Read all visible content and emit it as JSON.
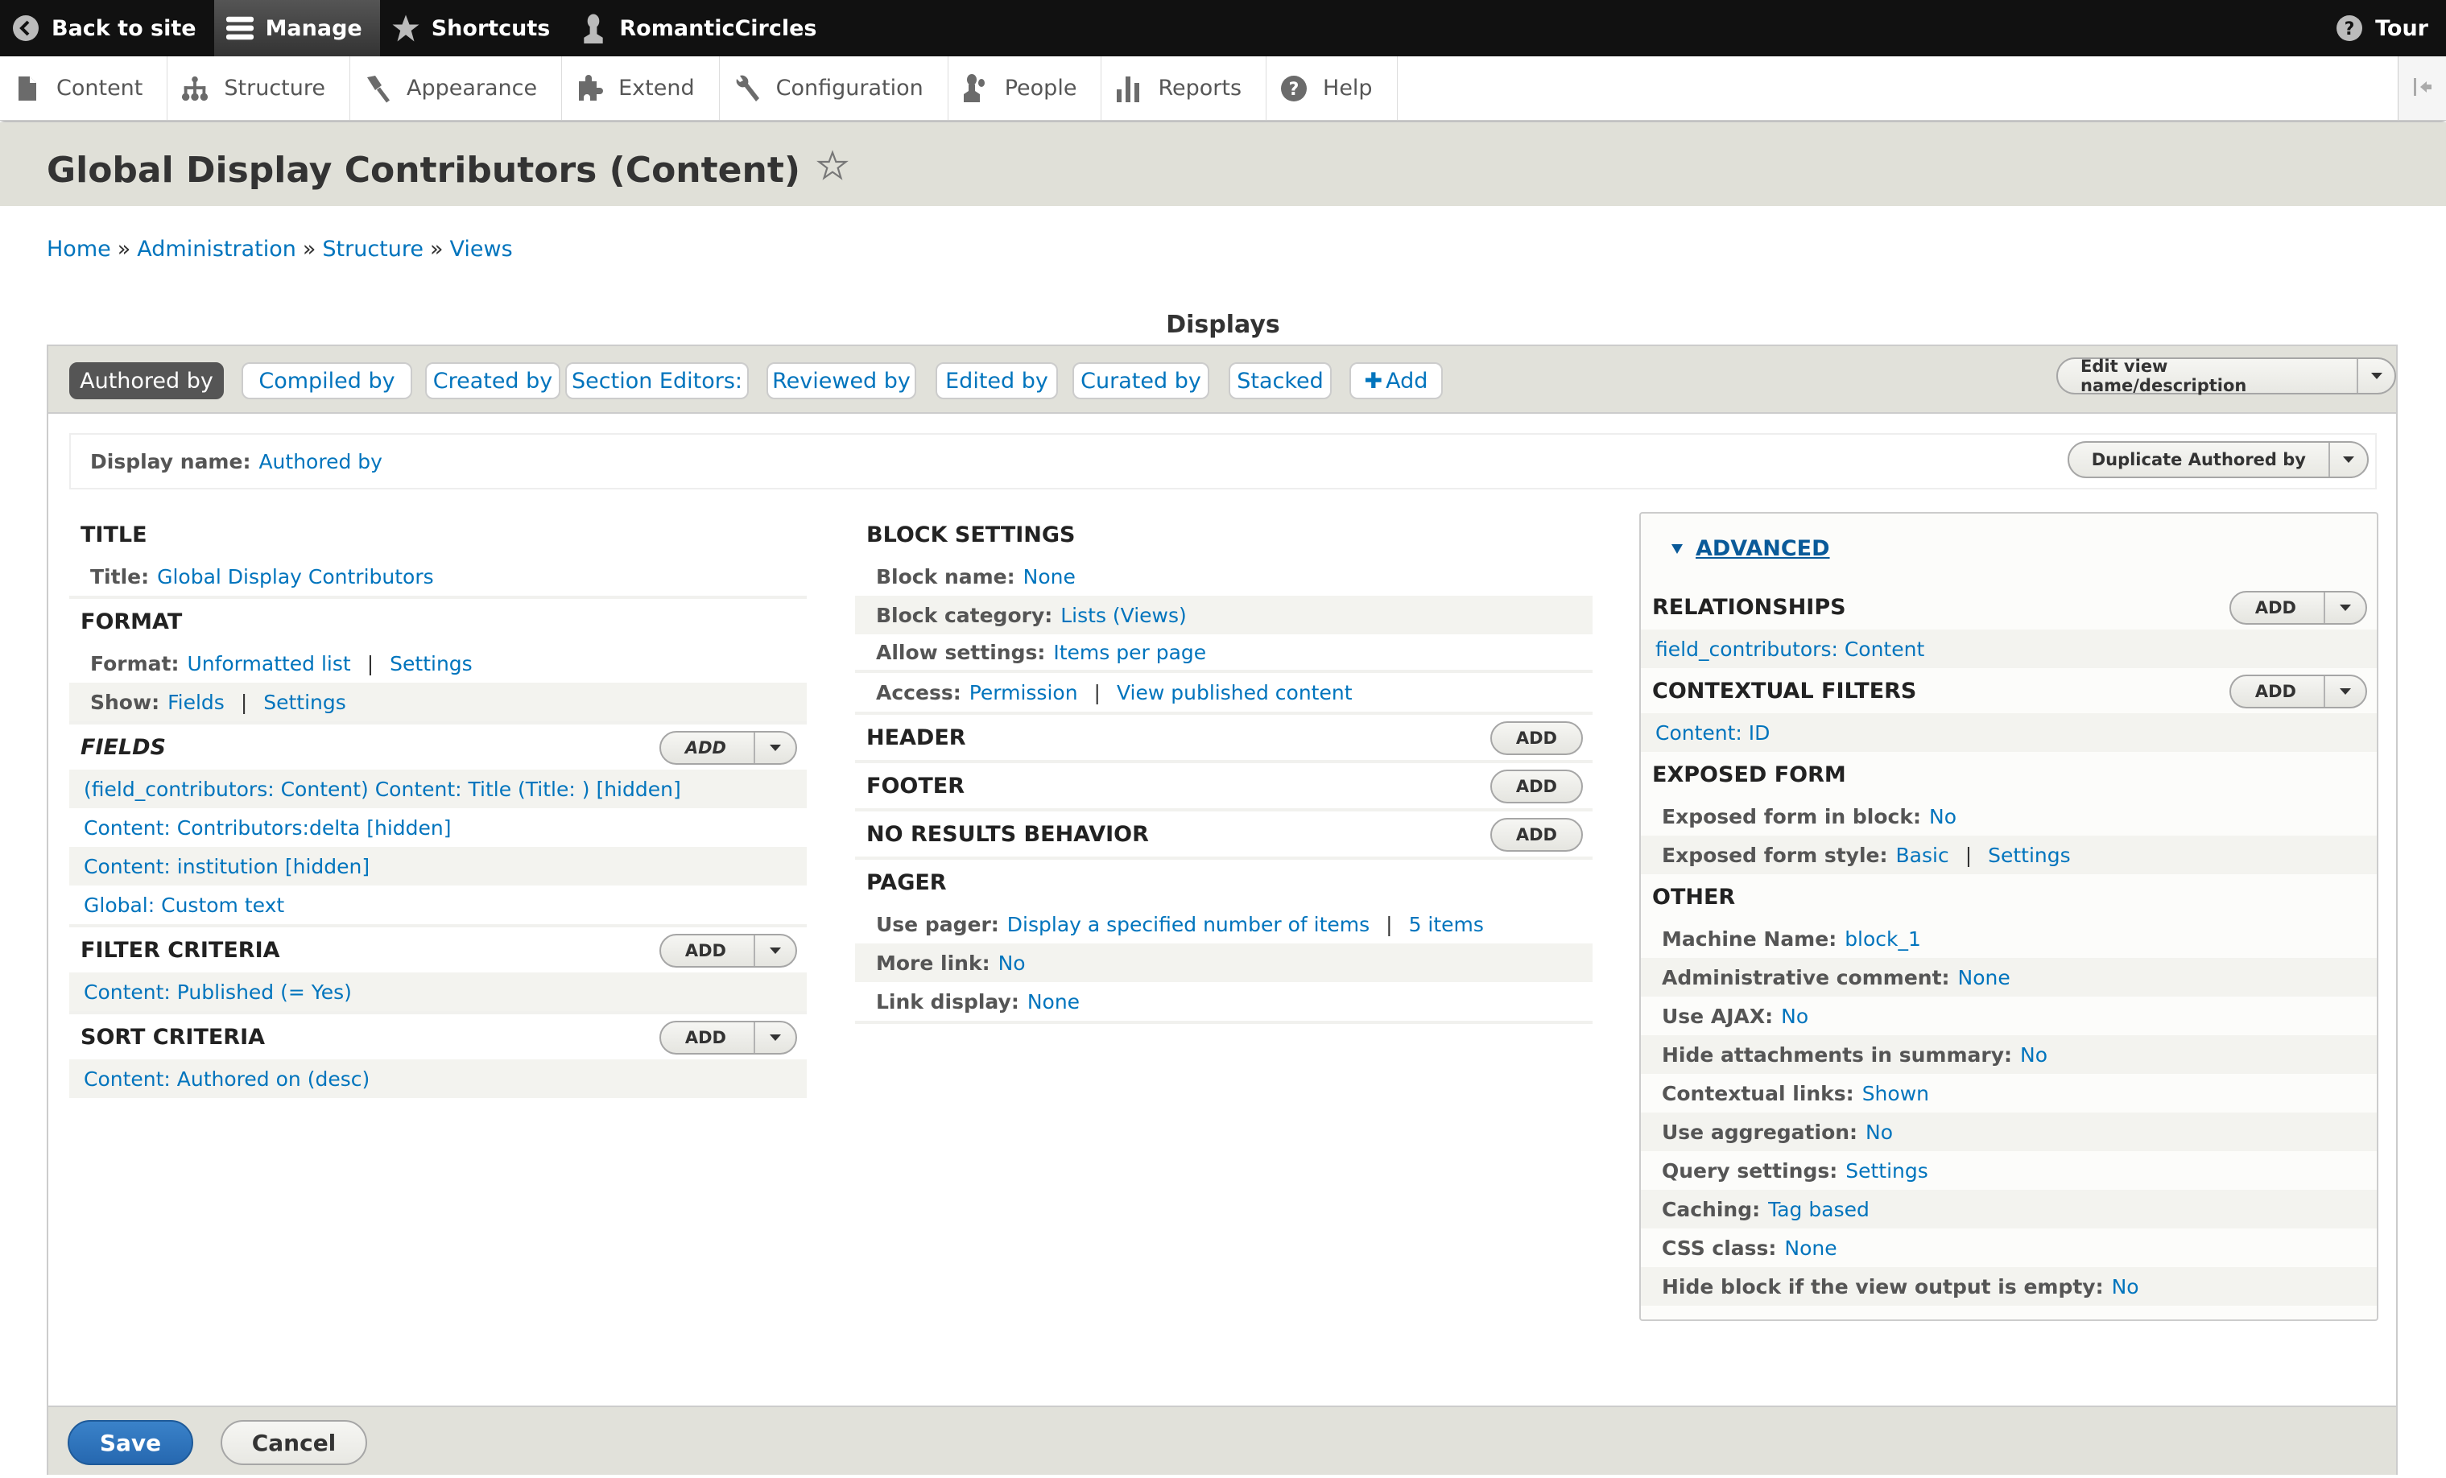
{
  "toolbar": {
    "back_to_site": "Back to site",
    "manage": "Manage",
    "shortcuts": "Shortcuts",
    "user": "RomanticCircles",
    "tour": "Tour"
  },
  "tray": {
    "items": [
      {
        "label": "Content",
        "icon": "file-icon"
      },
      {
        "label": "Structure",
        "icon": "sitemap-icon"
      },
      {
        "label": "Appearance",
        "icon": "paintbrush-icon"
      },
      {
        "label": "Extend",
        "icon": "puzzle-icon"
      },
      {
        "label": "Configuration",
        "icon": "wrench-icon"
      },
      {
        "label": "People",
        "icon": "person-icon"
      },
      {
        "label": "Reports",
        "icon": "bar-chart-icon"
      },
      {
        "label": "Help",
        "icon": "help-icon"
      }
    ]
  },
  "page": {
    "title": "Global Display Contributors (Content)",
    "breadcrumb": [
      "Home",
      "Administration",
      "Structure",
      "Views"
    ],
    "breadcrumb_sep": "»"
  },
  "displays": {
    "heading": "Displays",
    "tabs": [
      {
        "label": "Authored by",
        "active": true
      },
      {
        "label": "Compiled by"
      },
      {
        "label": "Created by"
      },
      {
        "label": "Section Editors:"
      },
      {
        "label": "Reviewed by"
      },
      {
        "label": "Edited by"
      },
      {
        "label": "Curated by"
      },
      {
        "label": "Stacked"
      },
      {
        "label": "Add",
        "icon": "plus-icon"
      }
    ],
    "edit_view_button": "Edit view name/description",
    "display_name_label": "Display name:",
    "display_name_value": "Authored by",
    "duplicate_button": "Duplicate Authored by"
  },
  "left": {
    "title": {
      "heading": "Title",
      "rows": [
        {
          "label": "Title:",
          "value": "Global Display Contributors"
        }
      ]
    },
    "format": {
      "heading": "Format",
      "rows": [
        {
          "label": "Format:",
          "value": "Unformatted list",
          "extra": "Settings"
        },
        {
          "label": "Show:",
          "value": "Fields",
          "extra": "Settings"
        }
      ]
    },
    "fields": {
      "heading": "Fields",
      "add": "Add",
      "items": [
        "(field_contributors: Content) Content: Title (Title: ) [hidden]",
        "Content: Contributors:delta [hidden]",
        "Content: institution [hidden]",
        "Global: Custom text"
      ]
    },
    "filter": {
      "heading": "Filter criteria",
      "add": "Add",
      "items": [
        "Content: Published (= Yes)"
      ]
    },
    "sort": {
      "heading": "Sort criteria",
      "add": "Add",
      "items": [
        "Content: Authored on (desc)"
      ]
    }
  },
  "middle": {
    "block": {
      "heading": "Block settings",
      "rows": [
        {
          "label": "Block name:",
          "value": "None"
        },
        {
          "label": "Block category:",
          "value": "Lists (Views)"
        },
        {
          "label": "Allow settings:",
          "value": "Items per page"
        },
        {
          "label": "Access:",
          "value": "Permission",
          "extra": "View published content"
        }
      ]
    },
    "header": {
      "heading": "Header",
      "add": "Add"
    },
    "footer": {
      "heading": "Footer",
      "add": "Add"
    },
    "no_results": {
      "heading": "No results behavior",
      "add": "Add"
    },
    "pager": {
      "heading": "Pager",
      "rows": [
        {
          "label": "Use pager:",
          "value": "Display a specified number of items",
          "extra": "5 items"
        },
        {
          "label": "More link:",
          "value": "No"
        },
        {
          "label": "Link display:",
          "value": "None"
        }
      ]
    }
  },
  "right": {
    "advanced_label": "Advanced",
    "relationships": {
      "heading": "Relationships",
      "add": "Add",
      "items": [
        "field_contributors: Content"
      ]
    },
    "contextual": {
      "heading": "Contextual filters",
      "add": "Add",
      "items": [
        "Content: ID"
      ]
    },
    "exposed": {
      "heading": "Exposed form",
      "rows": [
        {
          "label": "Exposed form in block:",
          "value": "No"
        },
        {
          "label": "Exposed form style:",
          "value": "Basic",
          "extra": "Settings"
        }
      ]
    },
    "other": {
      "heading": "Other",
      "rows": [
        {
          "label": "Machine Name:",
          "value": "block_1"
        },
        {
          "label": "Administrative comment:",
          "value": "None"
        },
        {
          "label": "Use AJAX:",
          "value": "No"
        },
        {
          "label": "Hide attachments in summary:",
          "value": "No"
        },
        {
          "label": "Contextual links:",
          "value": "Shown"
        },
        {
          "label": "Use aggregation:",
          "value": "No"
        },
        {
          "label": "Query settings:",
          "value": "Settings"
        },
        {
          "label": "Caching:",
          "value": "Tag based"
        },
        {
          "label": "CSS class:",
          "value": "None"
        },
        {
          "label": "Hide block if the view output is empty:",
          "value": "No"
        }
      ]
    }
  },
  "actions": {
    "save": "Save",
    "cancel": "Cancel"
  },
  "colors": {
    "link": "#0074bd",
    "primary_button": "#2f74bf",
    "toolbar_bg": "#111111",
    "header_bg": "#e0e0d8"
  }
}
